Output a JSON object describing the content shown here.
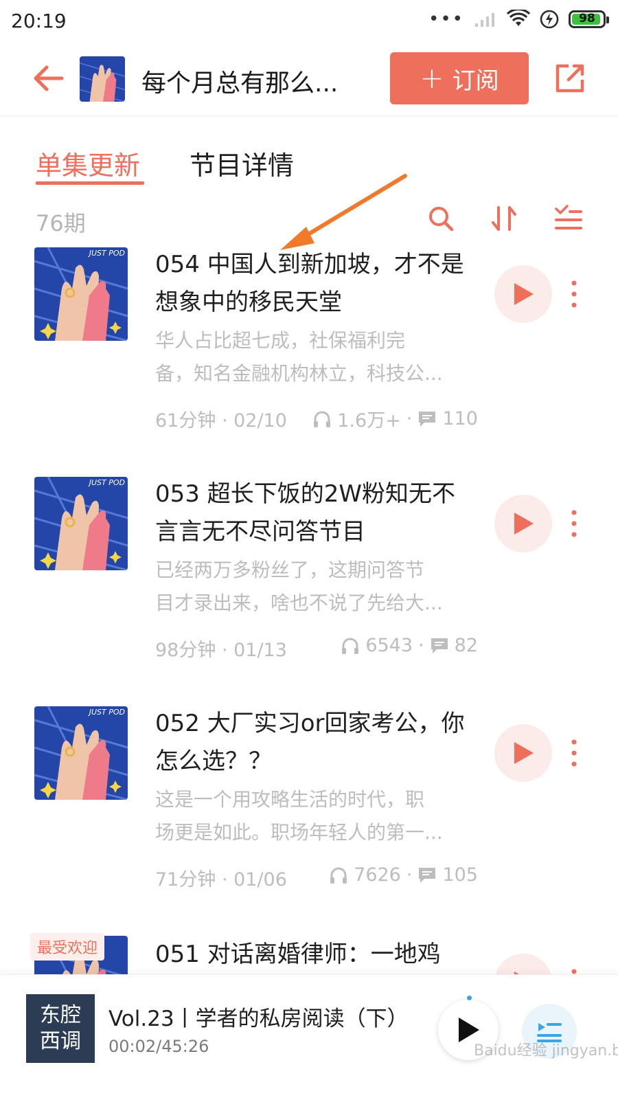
{
  "status_bar": {
    "time": "20:19",
    "battery": "98",
    "dots": "•••"
  },
  "header": {
    "back_icon": "back-arrow-icon",
    "title": "每个月总有那么...",
    "subscribe_plus": "+",
    "subscribe_label": "订阅",
    "share_icon": "share-icon",
    "accent_color": "#ee6f5b"
  },
  "tabs": [
    {
      "label": "单集更新",
      "active": true
    },
    {
      "label": "节目详情",
      "active": false
    }
  ],
  "episode_count": "76期",
  "tools": [
    "search-icon",
    "sort-icon",
    "filter-icon"
  ],
  "episodes": [
    {
      "title": "054 中国人到新加坡，才不是想象中的移民天堂",
      "desc_line1": "华人占比超七成，社保福利完",
      "desc_line2": "备，知名金融机构林立，科技公...",
      "meta": "61分钟 · 02/10",
      "plays": "1.6万+",
      "sep": "·",
      "comments": "110"
    },
    {
      "title": "053 超长下饭的2W粉知无不言言无不尽问答节目",
      "desc_line1": "已经两万多粉丝了，这期问答节",
      "desc_line2": "目才录出来，啥也不说了先给大...",
      "meta": "98分钟 · 01/13",
      "plays": "6543",
      "sep": "·",
      "comments": "82"
    },
    {
      "title": "052 大厂实习or回家考公，你怎么选？？",
      "desc_line1": "这是一个用攻略生活的时代，职",
      "desc_line2": "场更是如此。职场年轻人的第一...",
      "meta": "71分钟 · 01/06",
      "plays": "7626",
      "sep": "·",
      "comments": "105"
    },
    {
      "title": "051 对话离婚律师：一地鸡",
      "badge": "最受欢迎"
    }
  ],
  "cover_text": "JUST POD",
  "player": {
    "cover_line1": "东腔",
    "cover_line2": "西调",
    "title": "Vol.23丨学者的私房阅读（下）",
    "time": "00:02/45:26",
    "watermark": "Baidu经验 jingyan.baidu.com"
  }
}
